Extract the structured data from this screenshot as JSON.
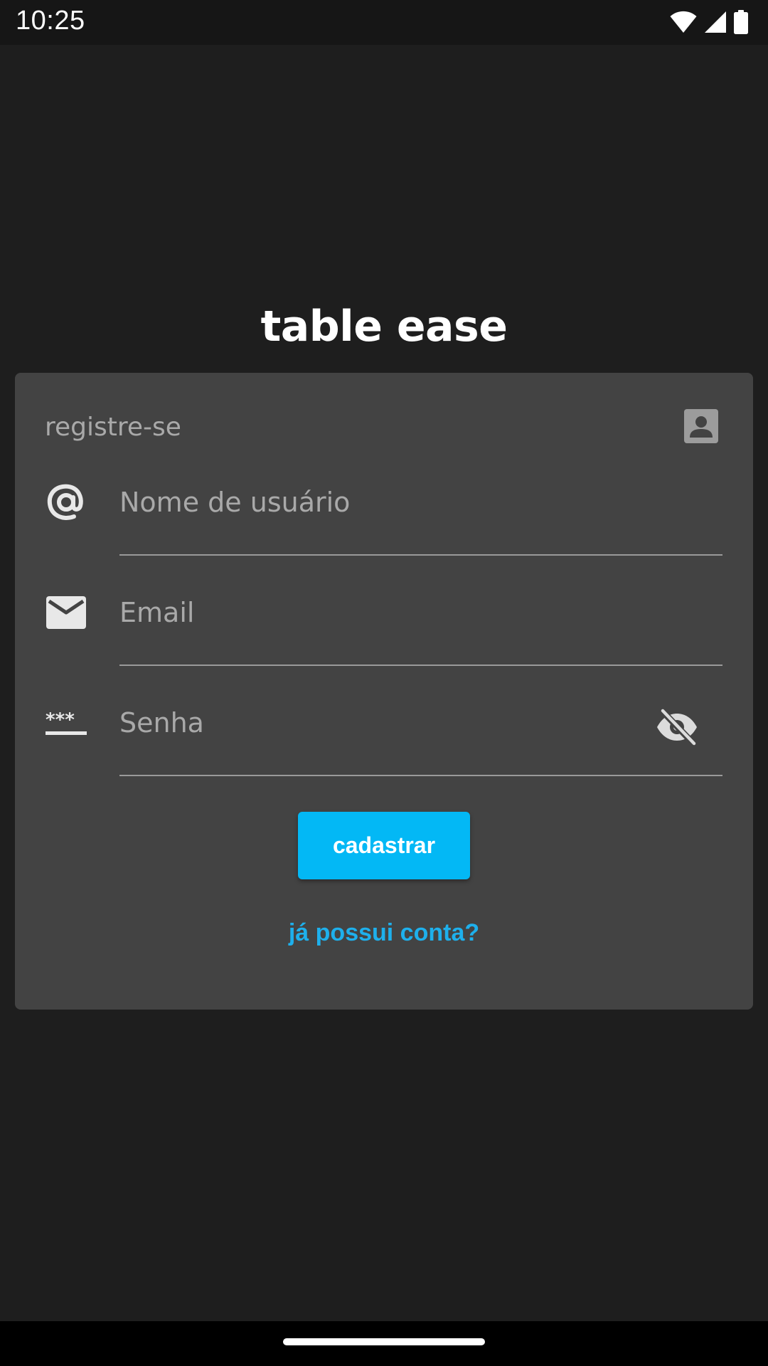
{
  "status_bar": {
    "time": "10:25",
    "icons": [
      "wifi-icon",
      "cellular-signal-icon",
      "battery-icon"
    ]
  },
  "app": {
    "title": "table ease"
  },
  "register_card": {
    "header_label": "registre-se",
    "header_icon": "account-box-icon",
    "fields": {
      "username": {
        "placeholder": "Nome de usuário",
        "value": "",
        "icon": "at-sign-icon"
      },
      "email": {
        "placeholder": "Email",
        "value": "",
        "icon": "envelope-icon"
      },
      "password": {
        "placeholder": "Senha",
        "value": "",
        "icon": "password-dots-icon",
        "toggle_icon": "eye-off-icon"
      }
    },
    "submit_label": "cadastrar",
    "login_link": "já possui conta?"
  },
  "colors": {
    "background": "#1e1e1e",
    "card": "#434343",
    "accent": "#03b8f5",
    "link": "#1eb0ec",
    "placeholder": "#a9a9a9"
  }
}
